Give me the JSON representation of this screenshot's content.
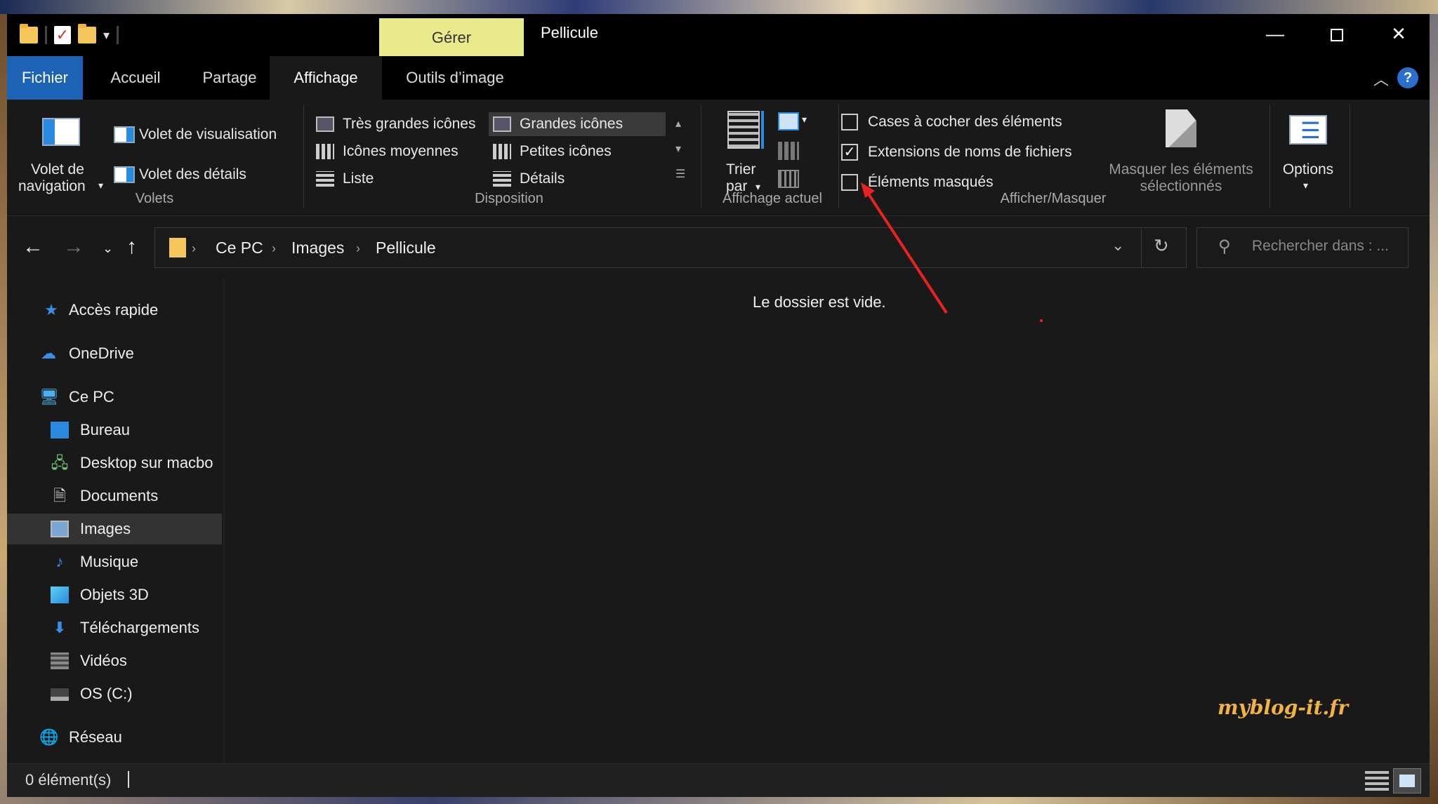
{
  "titlebar": {
    "context_tab": "Gérer",
    "title": "Pellicule",
    "minimize": "—",
    "close": "✕"
  },
  "tabs": {
    "fichier": "Fichier",
    "accueil": "Accueil",
    "partage": "Partage",
    "affichage": "Affichage",
    "outils": "Outils d’image"
  },
  "ribbon": {
    "volets": {
      "label": "Volets",
      "nav_pane_line1": "Volet de",
      "nav_pane_line2": "navigation",
      "preview_pane": "Volet de visualisation",
      "details_pane": "Volet des détails"
    },
    "disposition": {
      "label": "Disposition",
      "items": [
        "Très grandes icônes",
        "Grandes icônes",
        "Icônes moyennes",
        "Petites icônes",
        "Liste",
        "Détails"
      ],
      "selected": "Grandes icônes"
    },
    "affichage_actuel": {
      "label": "Affichage actuel",
      "sort_line1": "Trier",
      "sort_line2": "par"
    },
    "afficher_masquer": {
      "label": "Afficher/Masquer",
      "checkboxes": [
        {
          "label": "Cases à cocher des éléments",
          "checked": false
        },
        {
          "label": "Extensions de noms de fichiers",
          "checked": true
        },
        {
          "label": "Éléments masqués",
          "checked": false
        }
      ],
      "hide_selected_line1": "Masquer les éléments",
      "hide_selected_line2": "sélectionnés"
    },
    "options": {
      "label": "Options"
    }
  },
  "address": {
    "breadcrumb": [
      "Ce PC",
      "Images",
      "Pellicule"
    ],
    "search_placeholder": "Rechercher dans : ..."
  },
  "sidebar": {
    "items": [
      {
        "label": "Accès rapide",
        "icon": "star-icon"
      },
      {
        "label": "OneDrive",
        "icon": "cloud-icon"
      },
      {
        "label": "Ce PC",
        "icon": "computer-icon"
      },
      {
        "label": "Bureau",
        "icon": "desktop-icon"
      },
      {
        "label": "Desktop sur macbo",
        "icon": "network-drive-icon"
      },
      {
        "label": "Documents",
        "icon": "document-icon"
      },
      {
        "label": "Images",
        "icon": "picture-icon"
      },
      {
        "label": "Musique",
        "icon": "music-icon"
      },
      {
        "label": "Objets 3D",
        "icon": "cube-icon"
      },
      {
        "label": "Téléchargements",
        "icon": "download-icon"
      },
      {
        "label": "Vidéos",
        "icon": "video-icon"
      },
      {
        "label": "OS (C:)",
        "icon": "drive-icon"
      },
      {
        "label": "Réseau",
        "icon": "network-icon"
      }
    ],
    "selected": "Images"
  },
  "content": {
    "empty_message": "Le dossier est vide.",
    "watermark": "myblog-it.fr"
  },
  "status": {
    "item_count": "0 élément(s)"
  },
  "colors": {
    "accent": "#1c63b6",
    "context_tab": "#e8ea8c",
    "annotation_arrow": "#e8231f",
    "watermark": "#f2b440"
  }
}
